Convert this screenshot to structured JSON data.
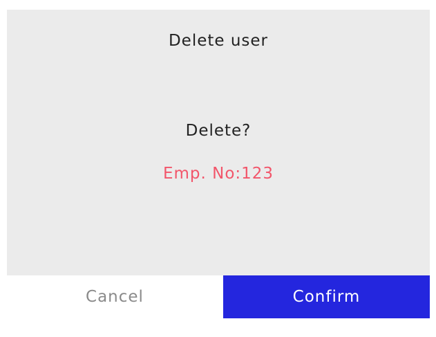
{
  "dialog": {
    "title": "Delete user",
    "question": "Delete?",
    "detail": "Emp. No:123",
    "cancel_label": "Cancel",
    "confirm_label": "Confirm"
  },
  "colors": {
    "panel_background": "#ebebeb",
    "detail_text": "#f2556a",
    "confirm_background": "#2426de",
    "cancel_text": "#8a8a8a"
  }
}
